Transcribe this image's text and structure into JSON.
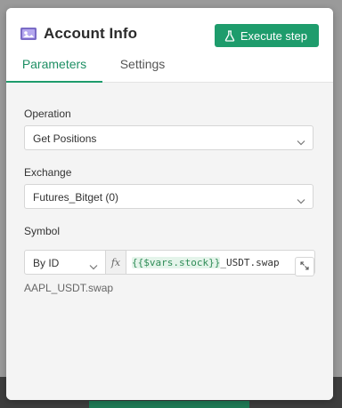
{
  "node": {
    "title": "Account Info",
    "icon": "account-card-icon",
    "execute_label": "Execute step"
  },
  "tabs": [
    {
      "label": "Parameters",
      "active": true
    },
    {
      "label": "Settings",
      "active": false
    }
  ],
  "fields": {
    "operation": {
      "label": "Operation",
      "value": "Get Positions"
    },
    "exchange": {
      "label": "Exchange",
      "value": "Futures_Bitget (0)"
    },
    "symbol": {
      "label": "Symbol",
      "mode": "By ID",
      "fx": "fx",
      "expression_var": "{{$vars.stock}}",
      "expression_rest": "_USDT.swap",
      "result": "AAPL_USDT.swap"
    }
  },
  "colors": {
    "accent": "#1e9c6c",
    "icon": "#7a6bc6"
  }
}
